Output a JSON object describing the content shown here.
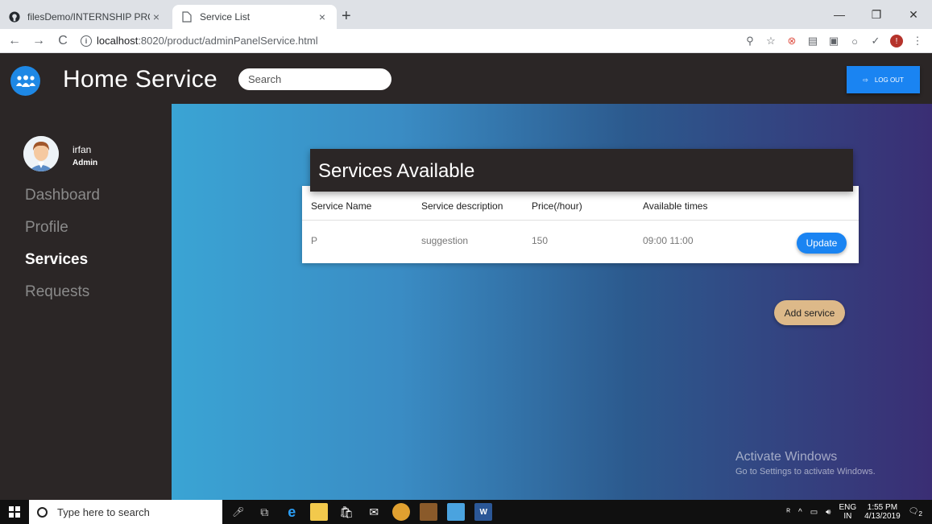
{
  "browser": {
    "tabs": [
      {
        "title": "filesDemo/INTERNSHIP PROJECT",
        "close": "×"
      },
      {
        "title": "Service List",
        "close": "×"
      }
    ],
    "new_tab": "+",
    "window_controls": {
      "minimize": "—",
      "restore": "❐",
      "close": "✕"
    },
    "nav": {
      "back": "←",
      "forward": "→",
      "reload": "C"
    },
    "url": {
      "host": "localhost",
      "path": ":8020/product/adminPanelService.html"
    }
  },
  "app": {
    "title": "Home Service",
    "search": {
      "placeholder": "Search"
    },
    "logout_label": "LOG OUT"
  },
  "sidebar": {
    "user": {
      "name": "irfan",
      "role": "Admin"
    },
    "items": [
      {
        "label": "Dashboard",
        "active": false
      },
      {
        "label": "Profile",
        "active": false
      },
      {
        "label": "Services",
        "active": true
      },
      {
        "label": "Requests",
        "active": false
      }
    ]
  },
  "services": {
    "title": "Services Available",
    "columns": [
      "Service Name",
      "Service description",
      "Price(/hour)",
      "Available times"
    ],
    "rows": [
      {
        "name": "P",
        "description": "suggestion",
        "price": "150",
        "times": "09:00 11:00",
        "action": "Update"
      }
    ],
    "add_label": "Add service"
  },
  "watermark": {
    "line1": "Activate Windows",
    "line2": "Go to Settings to activate Windows."
  },
  "taskbar": {
    "search_placeholder": "Type here to search",
    "lang": {
      "top": "ENG",
      "bottom": "IN"
    },
    "time": "1:55 PM",
    "date": "4/13/2019",
    "notification_count": "2"
  },
  "colors": {
    "header_bg": "#2b2626",
    "accent_blue": "#1a84f2",
    "add_button": "#ddb989"
  }
}
